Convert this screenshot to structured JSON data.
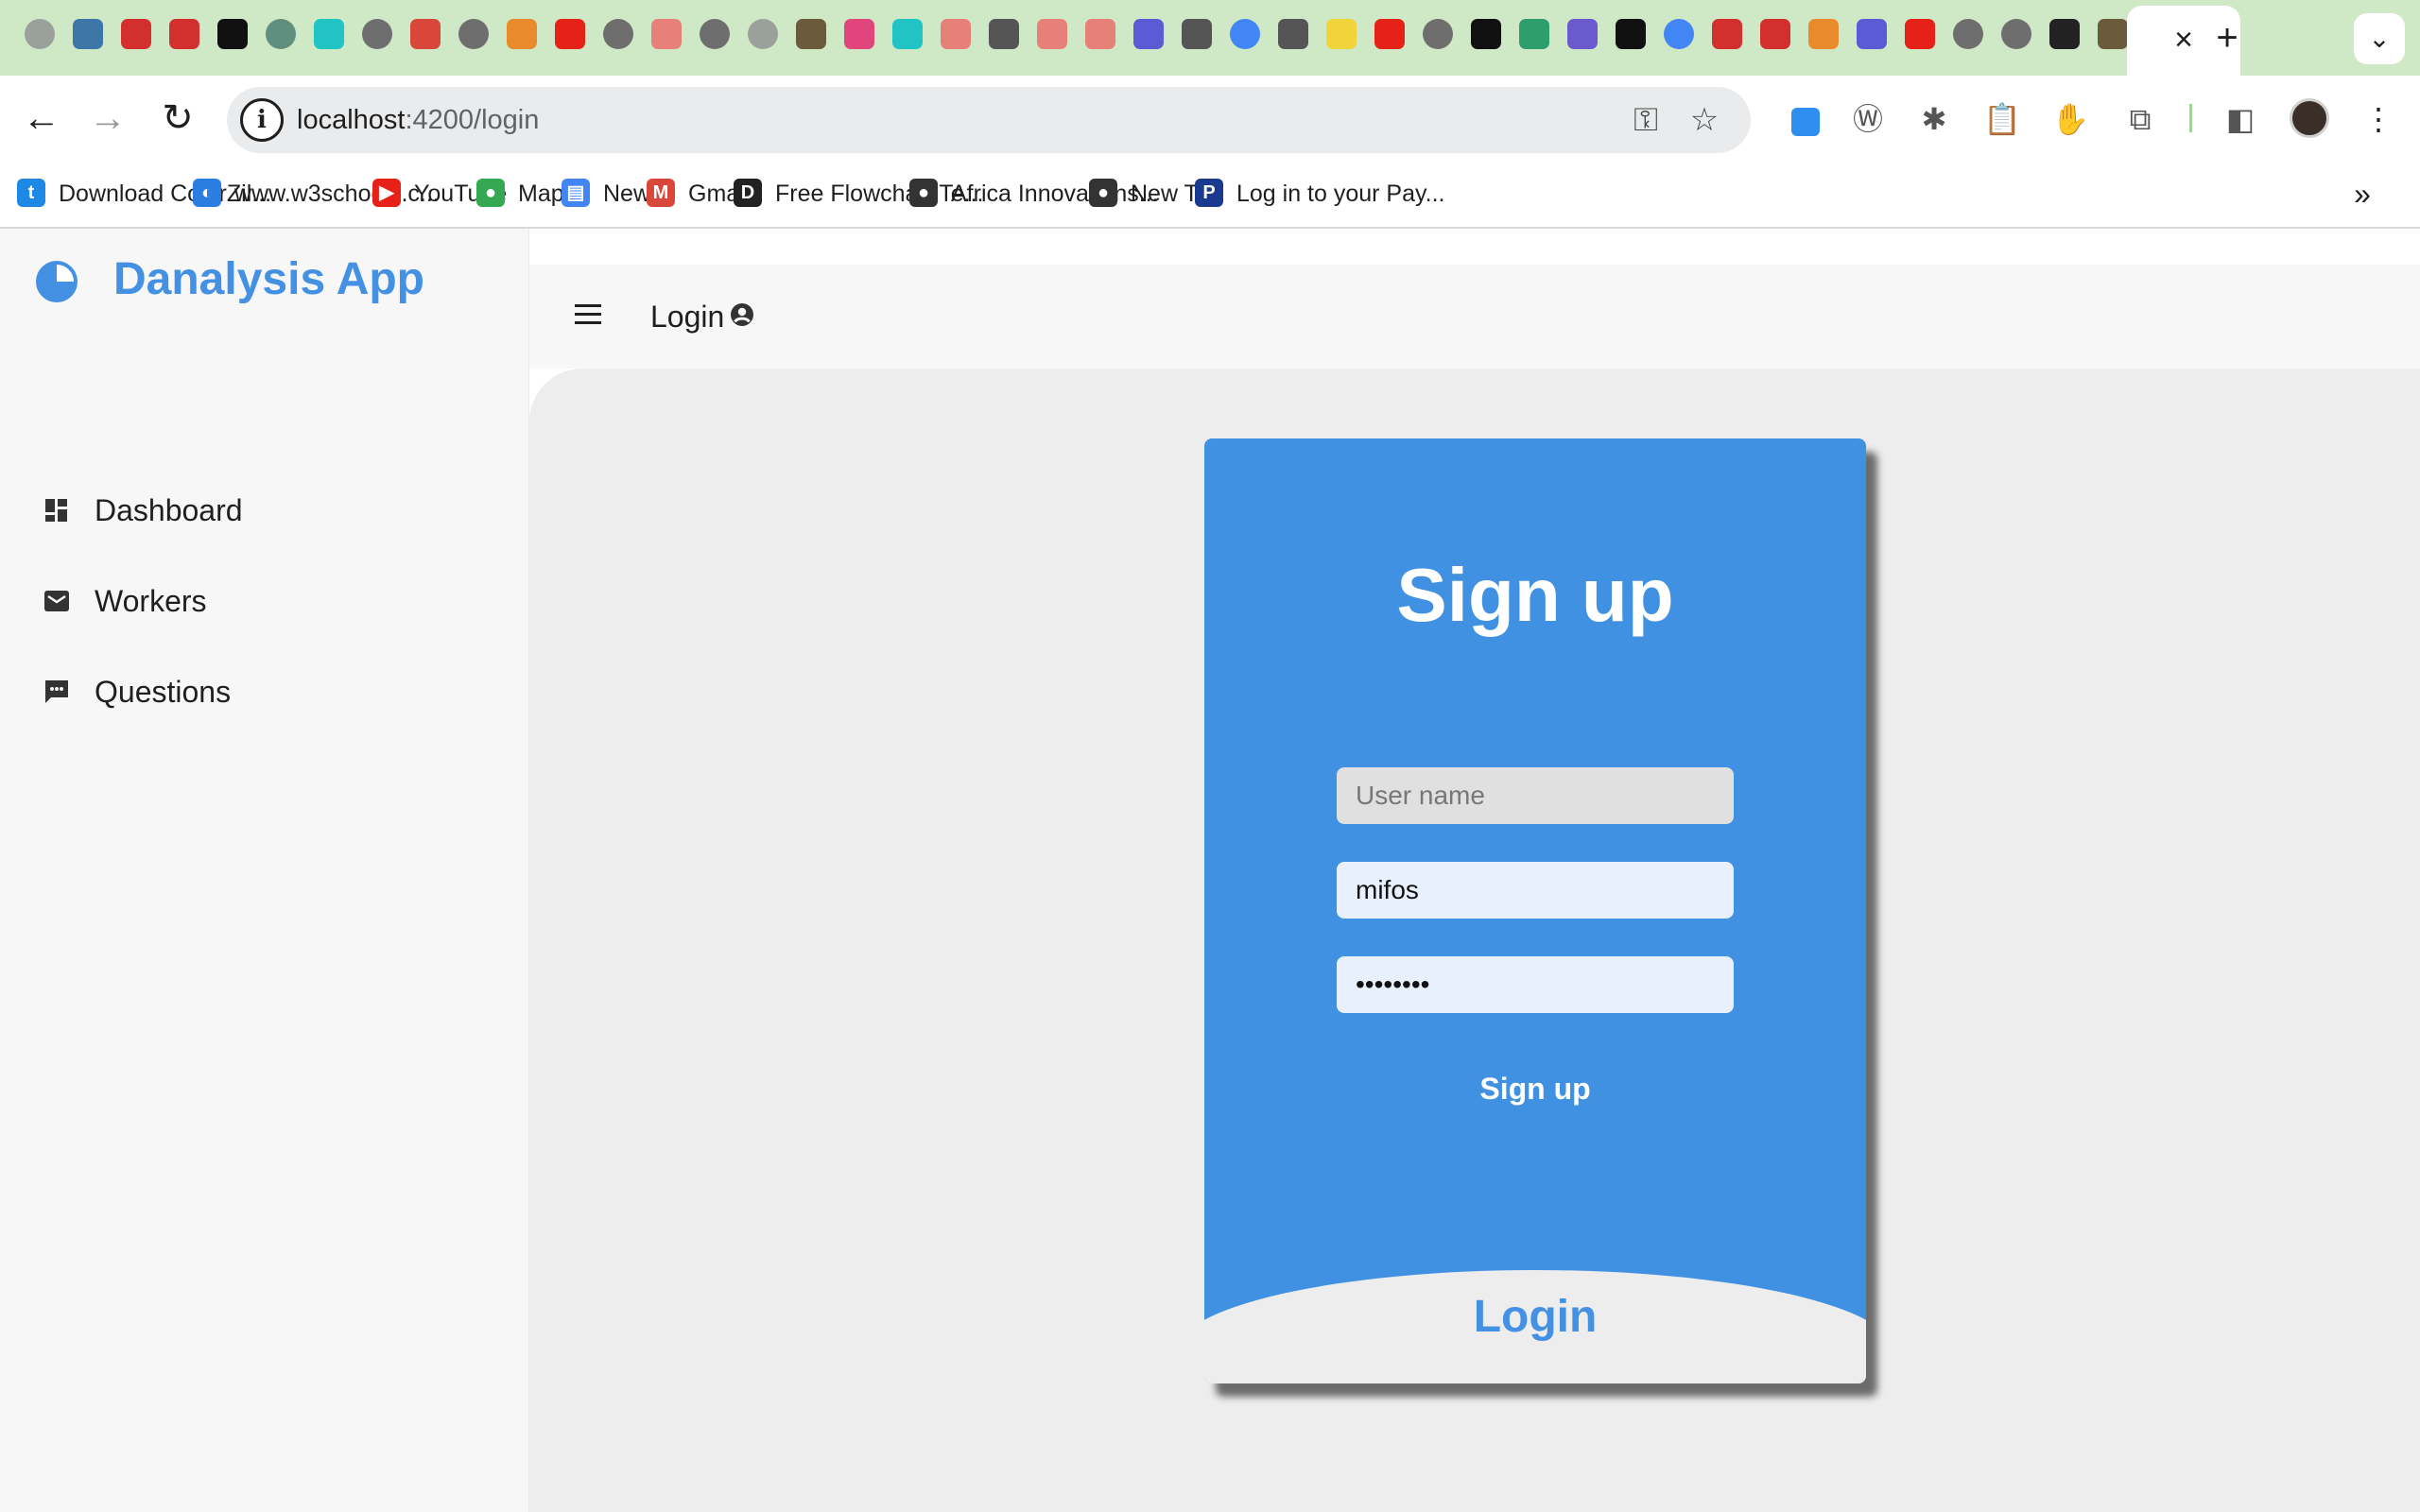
{
  "browser": {
    "tab_close_glyph": "×",
    "new_tab_glyph": "+",
    "tab_search_glyph": "⌄",
    "tab_favicons": [
      {
        "name": "chrome-tab-icon",
        "color": "#9aa09a",
        "round": true
      },
      {
        "name": "python-tab-icon",
        "color": "#3d77a8"
      },
      {
        "name": "angular-tab-icon",
        "color": "#d32f2f"
      },
      {
        "name": "angular-tab-icon",
        "color": "#d32f2f"
      },
      {
        "name": "medium-tab-icon",
        "color": "#111111"
      },
      {
        "name": "chatgpt-tab-icon",
        "color": "#5f8f7f",
        "round": true
      },
      {
        "name": "cube-tab-icon",
        "color": "#21c4c4"
      },
      {
        "name": "github-tab-icon",
        "color": "#6e6e6e",
        "round": true
      },
      {
        "name": "gmail-tab-icon",
        "color": "#d9473a"
      },
      {
        "name": "github-tab-icon",
        "color": "#6e6e6e",
        "round": true
      },
      {
        "name": "stackoverflow-tab-icon",
        "color": "#e98b2c"
      },
      {
        "name": "youtube-tab-icon",
        "color": "#e62117"
      },
      {
        "name": "github-tab-icon",
        "color": "#6e6e6e",
        "round": true
      },
      {
        "name": "todoist-tab-icon",
        "color": "#e8807a"
      },
      {
        "name": "github-tab-icon",
        "color": "#6e6e6e",
        "round": true
      },
      {
        "name": "chrome-tab-icon",
        "color": "#9aa09a",
        "round": true
      },
      {
        "name": "photo-tab-icon",
        "color": "#6b5a3c"
      },
      {
        "name": "cube-tab-icon",
        "color": "#e0457b"
      },
      {
        "name": "cube-tab-icon",
        "color": "#21c4c4"
      },
      {
        "name": "todoist-tab-icon",
        "color": "#e8807a"
      },
      {
        "name": "book-tab-icon",
        "color": "#555555"
      },
      {
        "name": "todoist-tab-icon",
        "color": "#e8807a"
      },
      {
        "name": "todoist-tab-icon",
        "color": "#e8807a"
      },
      {
        "name": "terminal-tab-icon",
        "color": "#5b5bd6"
      },
      {
        "name": "book-tab-icon",
        "color": "#555555"
      },
      {
        "name": "google-tab-icon",
        "color": "#4285f4",
        "round": true
      },
      {
        "name": "book-tab-icon",
        "color": "#555555"
      },
      {
        "name": "js-tab-icon",
        "color": "#f0d43a"
      },
      {
        "name": "youtube-tab-icon",
        "color": "#e62117"
      },
      {
        "name": "github-tab-icon",
        "color": "#6e6e6e",
        "round": true
      },
      {
        "name": "angular-tab-icon",
        "color": "#111111"
      },
      {
        "name": "network-tab-icon",
        "color": "#2e9e6a"
      },
      {
        "name": "h-tab-icon",
        "color": "#6a5acd"
      },
      {
        "name": "angular-tab-icon",
        "color": "#111111"
      },
      {
        "name": "google-tab-icon",
        "color": "#4285f4",
        "round": true
      },
      {
        "name": "angular-tab-icon",
        "color": "#d32f2f"
      },
      {
        "name": "angular-tab-icon",
        "color": "#d32f2f"
      },
      {
        "name": "stackoverflow-tab-icon",
        "color": "#e98b2c"
      },
      {
        "name": "terminal-tab-icon",
        "color": "#5b5bd6"
      },
      {
        "name": "youtube-tab-icon",
        "color": "#e62117"
      },
      {
        "name": "github-tab-icon",
        "color": "#6e6e6e",
        "round": true
      },
      {
        "name": "github-tab-icon",
        "color": "#6e6e6e",
        "round": true
      },
      {
        "name": "codepen-tab-icon",
        "color": "#222222"
      },
      {
        "name": "photo-tab-icon",
        "color": "#6b5a3c"
      }
    ],
    "url_host": "localhost",
    "url_path": ":4200/login",
    "bookmarks": [
      {
        "name": "bookmark-colorzilla",
        "label": "Download ColorZil...",
        "icon": "colorzilla-icon",
        "color": "#1e88e5",
        "glyph": "t"
      },
      {
        "name": "bookmark-w3schools",
        "label": "www.w3schools.c...",
        "icon": "w3schools-icon",
        "color": "#2a7de1",
        "glyph": "◐"
      },
      {
        "name": "bookmark-youtube",
        "label": "YouTube",
        "icon": "youtube-icon",
        "color": "#e62117",
        "glyph": "▶"
      },
      {
        "name": "bookmark-maps",
        "label": "Maps",
        "icon": "maps-icon",
        "color": "#34a853",
        "glyph": "●"
      },
      {
        "name": "bookmark-news",
        "label": "News",
        "icon": "news-icon",
        "color": "#4285f4",
        "glyph": "▤"
      },
      {
        "name": "bookmark-gmail",
        "label": "Gmail",
        "icon": "gmail-icon",
        "color": "#d9473a",
        "glyph": "M"
      },
      {
        "name": "bookmark-flowchart",
        "label": "Free Flowchart Te...",
        "icon": "flowchart-icon",
        "color": "#222222",
        "glyph": "D"
      },
      {
        "name": "bookmark-africa-innovations",
        "label": "Africa Innovations...",
        "icon": "globe-icon",
        "color": "#333333",
        "glyph": "●"
      },
      {
        "name": "bookmark-new-tab",
        "label": "New Tab",
        "icon": "globe-icon",
        "color": "#333333",
        "glyph": "●"
      },
      {
        "name": "bookmark-paypal",
        "label": "Log in to your Pay...",
        "icon": "paypal-icon",
        "color": "#1a3a8f",
        "glyph": "P"
      }
    ],
    "bookmarks_more_glyph": "»"
  },
  "app": {
    "brand": "Danalysis App",
    "accent": "#4491e3",
    "nav": [
      {
        "name": "sidebar-item-dashboard",
        "label": "Dashboard",
        "icon": "dashboard-icon"
      },
      {
        "name": "sidebar-item-workers",
        "label": "Workers",
        "icon": "mail-icon"
      },
      {
        "name": "sidebar-item-questions",
        "label": "Questions",
        "icon": "chat-icon"
      }
    ],
    "header": {
      "title": "Login"
    }
  },
  "card": {
    "title": "Sign up",
    "username_placeholder": "User name",
    "name_value": "mifos",
    "password_value": "mifosapp",
    "signup_label": "Sign up",
    "login_label": "Login",
    "card_color": "#4191e2"
  }
}
